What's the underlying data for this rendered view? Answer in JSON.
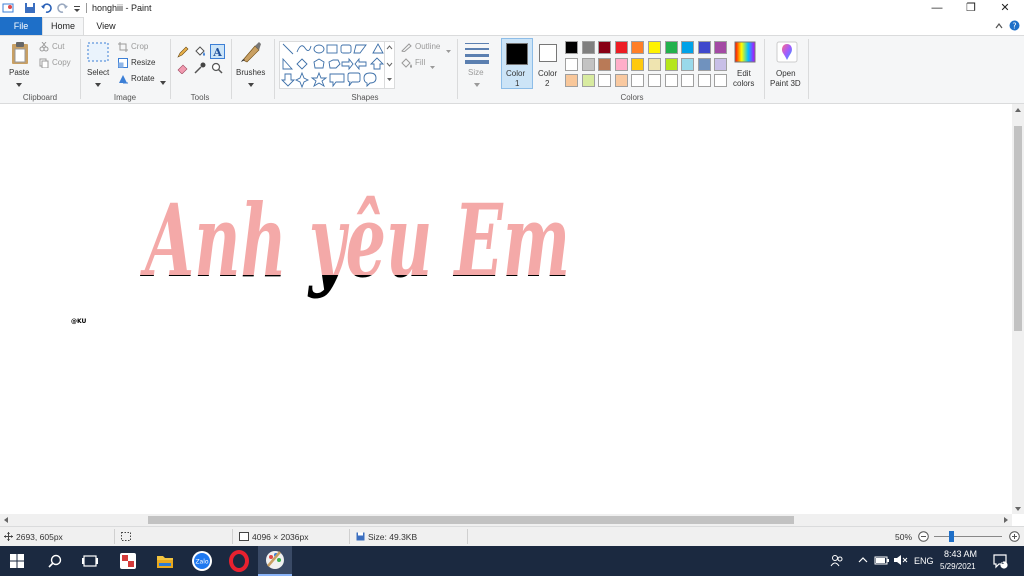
{
  "window": {
    "title": "honghiii - Paint",
    "controls": {
      "minimize": "—",
      "maximize": "❐",
      "close": "✕"
    }
  },
  "tabs": {
    "file": "File",
    "home": "Home",
    "view": "View"
  },
  "ribbon": {
    "clipboard": {
      "label": "Clipboard",
      "paste": "Paste",
      "cut": "Cut",
      "copy": "Copy"
    },
    "image": {
      "label": "Image",
      "select": "Select",
      "crop": "Crop",
      "resize": "Resize",
      "rotate": "Rotate"
    },
    "tools": {
      "label": "Tools"
    },
    "brushes": {
      "label": "Brushes"
    },
    "shapes": {
      "label": "Shapes",
      "outline": "Outline",
      "fill": "Fill"
    },
    "size": {
      "label": "Size"
    },
    "colors": {
      "label": "Colors",
      "color1_l1": "Color",
      "color1_l2": "1",
      "color2_l1": "Color",
      "color2_l2": "2",
      "edit_l1": "Edit",
      "edit_l2": "colors",
      "paint3d_l1": "Open",
      "paint3d_l2": "Paint 3D",
      "color1_value": "#000000",
      "color2_value": "#ffffff",
      "palette_row1": [
        "#000000",
        "#7f7f7f",
        "#880015",
        "#ed1c24",
        "#ff7f27",
        "#fff200",
        "#22b14c",
        "#00a2e8",
        "#3f48cc",
        "#a349a4"
      ],
      "palette_row2": [
        "#ffffff",
        "#c3c3c3",
        "#b97a57",
        "#ffaec9",
        "#ffc90e",
        "#efe4b0",
        "#b5e61d",
        "#99d9ea",
        "#7092be",
        "#c8bfe7"
      ],
      "palette_row3": [
        "#f8c79a",
        "#d8eba0",
        "#ffffff",
        "#f9c9a0",
        "#ffffff",
        "#ffffff",
        "#ffffff",
        "#ffffff",
        "#ffffff",
        "#ffffff"
      ]
    }
  },
  "canvas": {
    "artwork_text": "Anh yêu Em",
    "signature": "@KU",
    "ink_top_color": "#f4a9a8",
    "ink_bottom_color": "#000000"
  },
  "status": {
    "cursor": "2693, 605px",
    "dimensions": "4096 × 2036px",
    "size": "Size: 49.3KB",
    "zoom": "50%",
    "zoom_level": 0.5
  },
  "taskbar": {
    "lang": "ENG",
    "time": "8:43 AM",
    "date": "5/29/2021",
    "notif": "1"
  }
}
